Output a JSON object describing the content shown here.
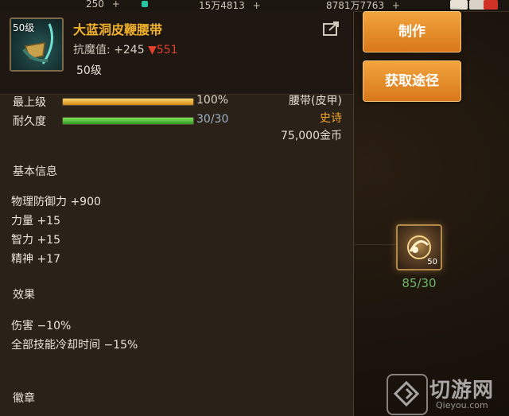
{
  "topbar": {
    "currency1": "250",
    "currency2": "15万4813",
    "currency3": "8781万7763",
    "plus": "+"
  },
  "item": {
    "icon_level": "50级",
    "name": "大蓝洞皮鞭腰带",
    "stat_label": "抗魔值:",
    "stat_value": "+245",
    "stat_compare": "▼551",
    "required_level": "50级",
    "type": "腰带(皮甲)",
    "rarity": "史诗",
    "price": "75,000金币"
  },
  "bars": {
    "upgrade_label": "最上级",
    "upgrade_value": "100%",
    "upgrade_fraction": 1.0,
    "durability_label": "耐久度",
    "durability_value": "30/30",
    "durability_fraction": 1.0
  },
  "sections": {
    "basic_title": "基本信息",
    "basic_attrs": [
      "物理防御力 +900",
      "力量 +15",
      "智力 +15",
      "精神 +17"
    ],
    "effect_title": "效果",
    "effect_attrs": [
      "伤害 −10%",
      "全部技能冷却时间 −15%"
    ],
    "emblem_title": "徽章"
  },
  "buttons": {
    "make": "制作",
    "source": "获取途径"
  },
  "material": {
    "slot_level": "50",
    "count": "85/30"
  },
  "watermark": {
    "text": "切游网",
    "url": "Qieyou.com"
  },
  "colors": {
    "rarity_epic": "#f1a52c",
    "button_orange": "#e08a26",
    "count_green": "#6fb46a",
    "decrease_red": "#e0402f"
  }
}
